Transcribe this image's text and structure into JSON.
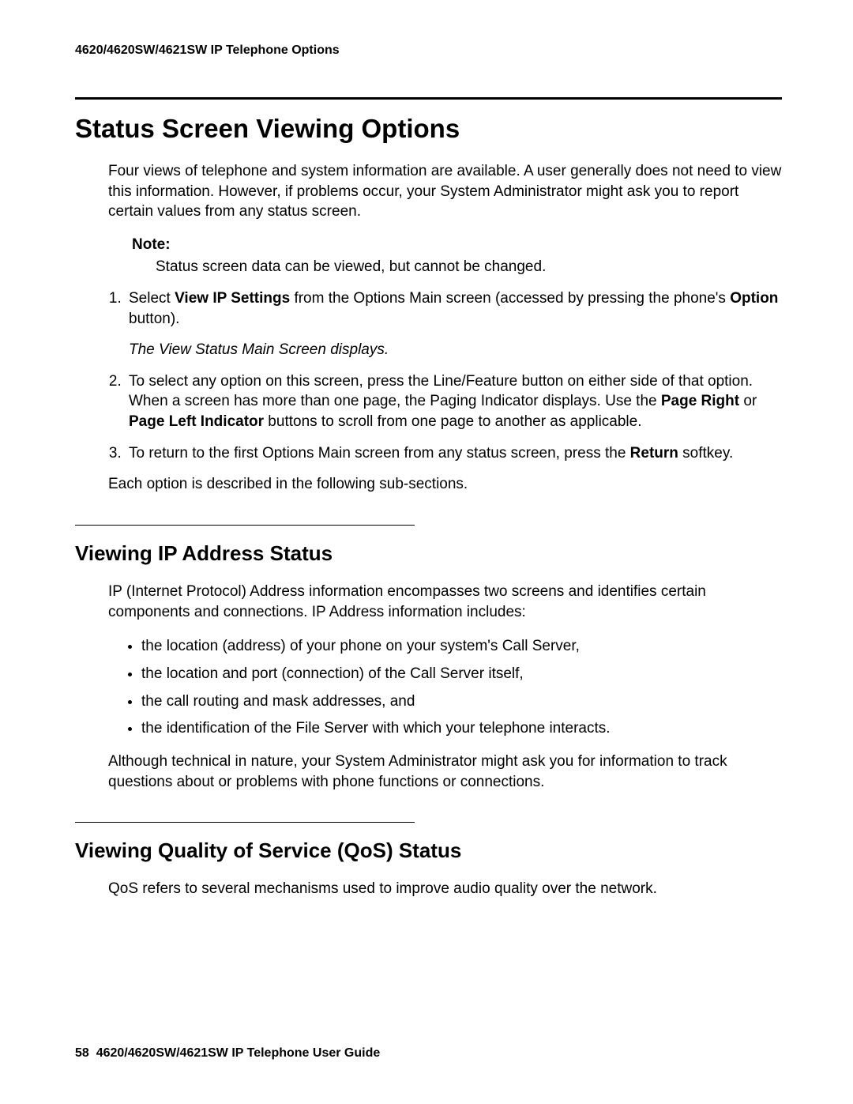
{
  "header": {
    "running_title": "4620/4620SW/4621SW IP Telephone Options"
  },
  "section1": {
    "title": "Status Screen Viewing Options",
    "intro": "Four views of telephone and system information are available. A user generally does not need to view this information. However, if problems occur, your System Administrator might ask you to report certain values from any status screen.",
    "note_label": "Note:",
    "note_body": "Status screen data can be viewed, but cannot be changed.",
    "step1_pre": "Select ",
    "step1_bold1": "View IP Settings",
    "step1_mid": " from the Options Main screen (accessed by pressing the phone's ",
    "step1_bold2": "Option",
    "step1_post": " button).",
    "step1_result": "The View Status Main Screen displays.",
    "step2_pre": "To select any option on this screen, press the Line/Feature button on either side of that option. When a screen has more than one page, the Paging Indicator displays. Use the ",
    "step2_bold1": "Page Right",
    "step2_mid": " or ",
    "step2_bold2": "Page Left Indicator",
    "step2_post": " buttons to scroll from one page to another as applicable.",
    "step3_pre": "To return to the first Options Main screen from any status screen, press the ",
    "step3_bold": "Return",
    "step3_post": " softkey.",
    "after_list": "Each option is described in the following sub-sections."
  },
  "section2": {
    "title": "Viewing IP Address Status",
    "intro": "IP (Internet Protocol) Address information encompasses two screens and identifies certain components and connections. IP Address information includes:",
    "bullets": [
      "the location (address) of your phone on your system's Call Server,",
      "the location and port (connection) of the Call Server itself,",
      "the call routing and mask addresses, and",
      "the identification of the File Server with which your telephone interacts."
    ],
    "outro": "Although technical in nature, your System Administrator might ask you for information to track questions about or problems with phone functions or connections."
  },
  "section3": {
    "title": "Viewing Quality of Service (QoS) Status",
    "intro": "QoS refers to several mechanisms used to improve audio quality over the network."
  },
  "footer": {
    "page_number": "58",
    "doc_title": "4620/4620SW/4621SW IP Telephone User Guide"
  }
}
